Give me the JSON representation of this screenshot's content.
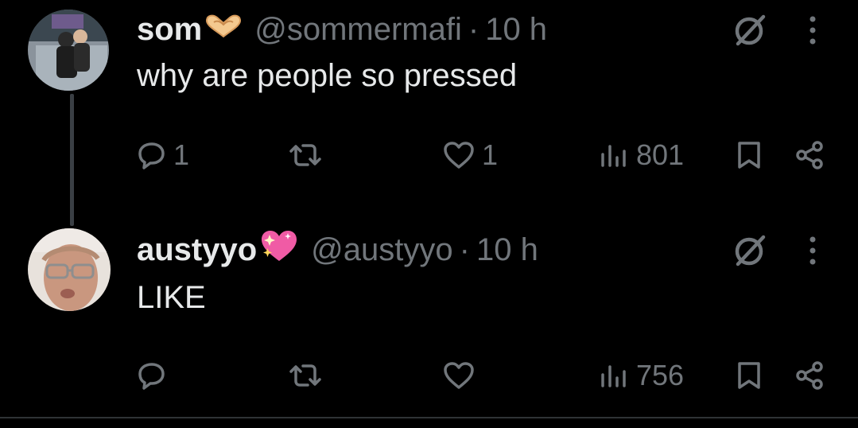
{
  "tweets": [
    {
      "name": "som",
      "name_emoji": "heart-hands",
      "handle": "@sommermafi",
      "separator": "·",
      "time": "10 h",
      "text": "why are people so pressed",
      "replies": "1",
      "reposts": "",
      "likes": "1",
      "views": "801"
    },
    {
      "name": "austyyo",
      "name_emoji": "sparkling-heart",
      "handle": "@austyyo",
      "separator": "·",
      "time": "10 h",
      "text": "LIKE",
      "replies": "",
      "reposts": "",
      "likes": "",
      "views": "756"
    }
  ],
  "colors": {
    "background": "#000000",
    "text": "#e7e9ea",
    "muted": "#71767b",
    "thread_line": "#3a3f44"
  },
  "icons": [
    "grok-icon",
    "more-icon",
    "reply-icon",
    "repost-icon",
    "like-icon",
    "views-icon",
    "bookmark-icon",
    "share-icon"
  ]
}
